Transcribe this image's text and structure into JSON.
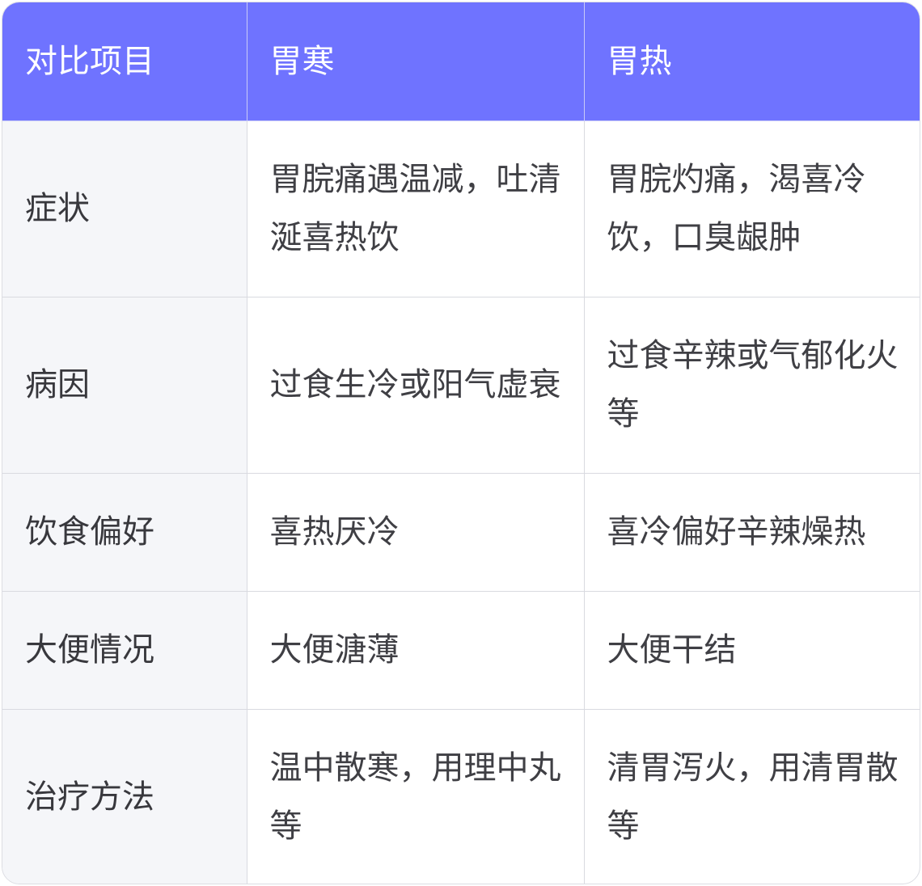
{
  "table": {
    "headers": [
      "对比项目",
      "胃寒",
      "胃热"
    ],
    "rows": [
      {
        "label": "症状",
        "cold": "胃脘痛遇温减，吐清涎喜热饮",
        "heat": "胃脘灼痛，渴喜冷饮，口臭龈肿"
      },
      {
        "label": "病因",
        "cold": "过食生冷或阳气虚衰",
        "heat": "过食辛辣或气郁化火等"
      },
      {
        "label": "饮食偏好",
        "cold": "喜热厌冷",
        "heat": "喜冷偏好辛辣燥热"
      },
      {
        "label": "大便情况",
        "cold": "大便溏薄",
        "heat": "大便干结"
      },
      {
        "label": "治疗方法",
        "cold": "温中散寒，用理中丸等",
        "heat": "清胃泻火，用清胃散等"
      }
    ]
  },
  "colors": {
    "header_bg": "#6f73ff",
    "header_text": "#ffffff",
    "label_bg": "#f5f6f9",
    "border": "#d9dae0"
  }
}
